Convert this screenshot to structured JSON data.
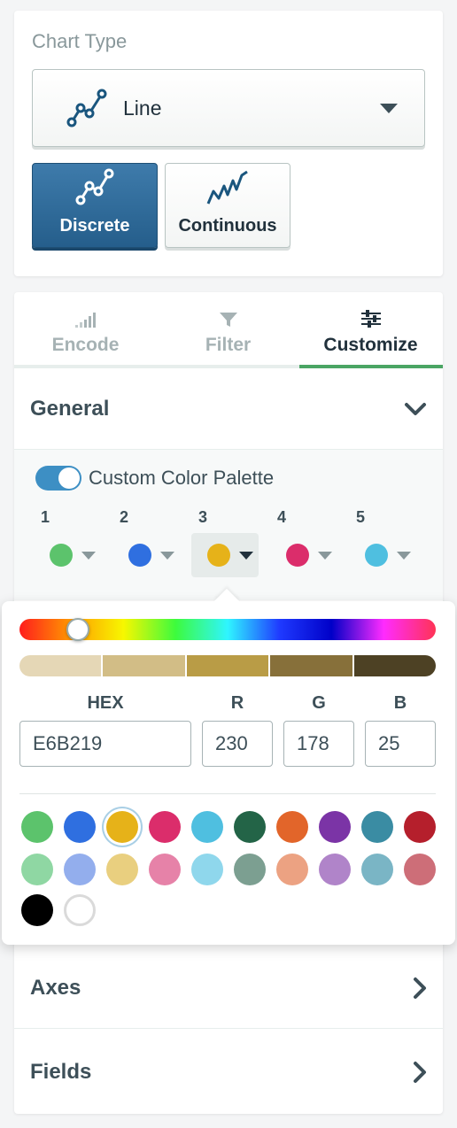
{
  "chart_type": {
    "section_label": "Chart Type",
    "selected": "Line",
    "subtypes": [
      {
        "label": "Discrete",
        "active": true,
        "icon": "discrete-line-icon"
      },
      {
        "label": "Continuous",
        "active": false,
        "icon": "continuous-line-icon"
      }
    ]
  },
  "tabs": [
    {
      "label": "Encode",
      "icon": "bar-signal-icon",
      "active": false
    },
    {
      "label": "Filter",
      "icon": "filter-funnel-icon",
      "active": false
    },
    {
      "label": "Customize",
      "icon": "sliders-icon",
      "active": true
    }
  ],
  "general": {
    "title": "General",
    "expanded": true,
    "custom_palette_label": "Custom Color Palette",
    "custom_palette_enabled": true,
    "palette": [
      {
        "index": "1",
        "color": "#5cc36c"
      },
      {
        "index": "2",
        "color": "#2f6fe0"
      },
      {
        "index": "3",
        "color": "#e6b219",
        "active": true
      },
      {
        "index": "4",
        "color": "#db2d6b"
      },
      {
        "index": "5",
        "color": "#4fbfe0"
      }
    ]
  },
  "color_picker": {
    "hex_label": "HEX",
    "r_label": "R",
    "g_label": "G",
    "b_label": "B",
    "hex": "E6B219",
    "r": "230",
    "g": "178",
    "b": "25",
    "hue_position": 0.14,
    "shades": [
      "#e5d7b6",
      "#d2bd86",
      "#b99c46",
      "#87703a",
      "#4d4124"
    ],
    "presets_row1": [
      "#5cc36c",
      "#2f6fe0",
      "#e6b219",
      "#db2d6b",
      "#4fbfe0",
      "#236447",
      "#e2652a",
      "#7b34a6",
      "#3a8ca3",
      "#b51f2c"
    ],
    "presets_row2": [
      "#8fd7a3",
      "#93aeed",
      "#e9cf7f",
      "#e682a8",
      "#8fd7ec",
      "#7c9f91",
      "#eca282",
      "#b084c9",
      "#7ab5c5",
      "#cd6e78"
    ],
    "presets_row3": [
      "#000000",
      "#ffffff"
    ]
  },
  "axes": {
    "title": "Axes"
  },
  "fields": {
    "title": "Fields"
  }
}
